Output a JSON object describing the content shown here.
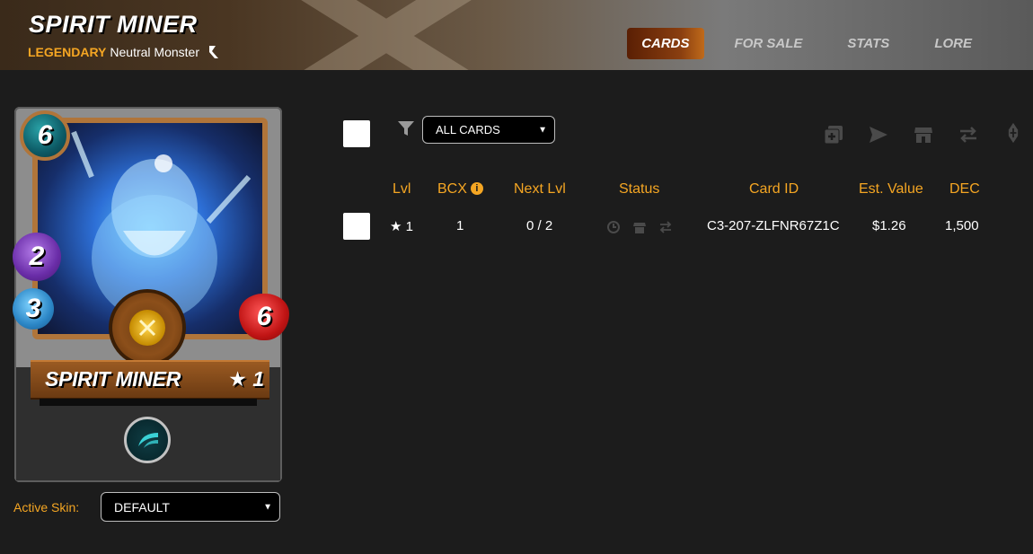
{
  "header": {
    "title": "SPIRIT MINER",
    "rarity": "LEGENDARY",
    "type": "Neutral Monster",
    "tabs": [
      {
        "label": "CARDS",
        "active": true
      },
      {
        "label": "FOR SALE",
        "active": false
      },
      {
        "label": "STATS",
        "active": false
      },
      {
        "label": "LORE",
        "active": false
      }
    ]
  },
  "card": {
    "name": "SPIRIT MINER",
    "level": "★ 1",
    "mana": "6",
    "magic": "2",
    "speed": "3",
    "health": "6",
    "ability_icon": "sneak-ability-icon"
  },
  "skin": {
    "label": "Active Skin:",
    "selected": "DEFAULT"
  },
  "filter": {
    "selected": "ALL CARDS"
  },
  "table": {
    "headers": [
      "Lvl",
      "BCX",
      "Next Lvl",
      "Status",
      "Card ID",
      "Est. Value",
      "DEC"
    ],
    "rows": [
      {
        "lvl": "★ 1",
        "bcx": "1",
        "next_lvl": "0 / 2",
        "card_id": "C3-207-ZLFNR67Z1C",
        "est_value": "$1.26",
        "dec": "1,500"
      }
    ]
  },
  "colors": {
    "accent": "#f5a623",
    "background": "#1c1c1c",
    "tab_active": "#8a3f10"
  }
}
